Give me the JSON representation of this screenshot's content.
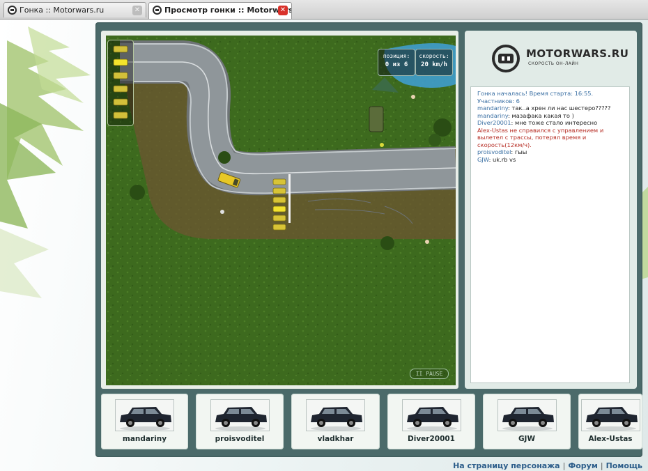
{
  "tabs": [
    {
      "title": "Гонка :: Motorwars.ru",
      "active": false
    },
    {
      "title": "Просмотр гонки :: Motorwars.ru",
      "active": true
    }
  ],
  "hud": {
    "position_label": "позиция:",
    "position_value": "0 из 6",
    "speed_label": "скорость:",
    "speed_value": "20 km/h",
    "pause_label": "II PAUSE"
  },
  "logo": {
    "title": "MOTORWARS.RU",
    "subtitle": "СКОРОСТЬ ОН-ЛАЙН"
  },
  "chat": [
    {
      "type": "system",
      "text": "Гонка началась! Время старта: 16:55. Участников: 6"
    },
    {
      "type": "msg",
      "nick": "mandariny",
      "text": "так..а хрен ли нас шестеро?????"
    },
    {
      "type": "msg",
      "nick": "mandariny",
      "text": "мазафака какая то )"
    },
    {
      "type": "msg",
      "nick": "Diver20001",
      "text": "мне тоже стало интересно"
    },
    {
      "type": "alert",
      "text": "Alex-Ustas не справился с управлением и вылетел с трассы, потерял время и скорость(12км/ч)."
    },
    {
      "type": "msg",
      "nick": "proisvoditel",
      "text": "гыы"
    },
    {
      "type": "msg",
      "nick": "GJW",
      "text": "uk.rb vs"
    }
  ],
  "players": [
    "mandariny",
    "proisvoditel",
    "vladkhar",
    "Diver20001",
    "GJW",
    "Alex-Ustas"
  ],
  "footer": {
    "character_link": "На страницу персонажа",
    "forum_link": "Форум",
    "help_link": "Помощь"
  },
  "colors": {
    "frame": "#4b6a6a",
    "grass": "#3f6a1f",
    "road": "#8c9396",
    "accent_red": "#b52b22",
    "link": "#2c5d8a"
  }
}
